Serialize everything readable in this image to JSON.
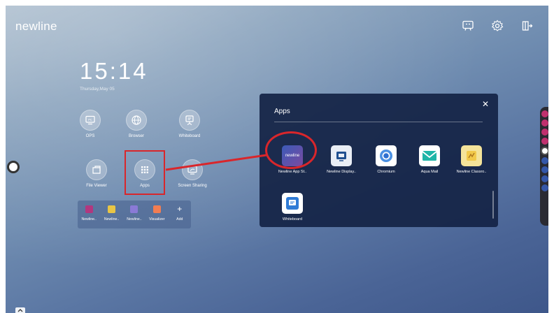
{
  "brand": {
    "logo_text": "newline"
  },
  "clock": {
    "time": "15:14",
    "date": "Thursday,May 05"
  },
  "top_bar": {
    "icons": [
      "monitor-icon",
      "gear-icon",
      "exit-icon"
    ]
  },
  "home_tiles": [
    {
      "label": "OPS",
      "icon": "pc-icon"
    },
    {
      "label": "Browser",
      "icon": "globe-icon"
    },
    {
      "label": "Whiteboard",
      "icon": "whiteboard-icon"
    },
    {
      "label": "File Viewer",
      "icon": "folder-icon"
    },
    {
      "label": "Apps",
      "icon": "grid-icon"
    },
    {
      "label": "Screen Sharing",
      "icon": "cast-icon"
    }
  ],
  "dock": {
    "items": [
      {
        "label": "Newline..",
        "color": "#b2377f"
      },
      {
        "label": "Newline..",
        "color": "#e8c545"
      },
      {
        "label": "Newline..",
        "color": "#8a7ad6"
      },
      {
        "label": "Visualizer",
        "color": "#f27d52"
      },
      {
        "label": "Add",
        "icon": "plus-icon"
      }
    ]
  },
  "apps_panel": {
    "title": "Apps",
    "close": "✕",
    "apps": [
      {
        "label": "Newline App St..",
        "color": "#5c4aa8",
        "icon_text": "newline"
      },
      {
        "label": "Newline Display..",
        "color": "#e9eef5"
      },
      {
        "label": "Chromium",
        "color": "#ffffff"
      },
      {
        "label": "Aqua Mail",
        "color": "#ffffff"
      },
      {
        "label": "Newline Classro..",
        "color": "#f4e39a"
      },
      {
        "label": "Whiteboard",
        "color": "#ffffff"
      }
    ]
  },
  "colors": {
    "highlight": "#d9262b",
    "panel": "#14234a"
  }
}
